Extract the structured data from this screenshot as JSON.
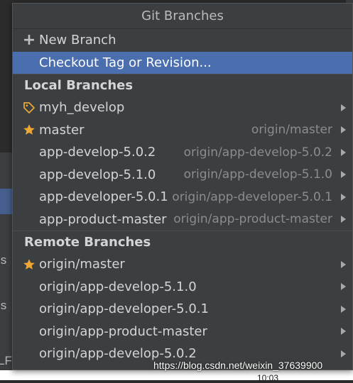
{
  "background": {
    "left_fragments": [
      "is",
      "is",
      "LF"
    ],
    "bottom_clock": "10:03"
  },
  "popup": {
    "title": "Git Branches",
    "actions": [
      {
        "label": "New Branch",
        "icon": "plus-icon"
      },
      {
        "label": "Checkout Tag or Revision...",
        "selected": true
      }
    ],
    "local_header": "Local Branches",
    "local_branches": [
      {
        "name": "myh_develop",
        "tracking": "",
        "icon": "tag-icon"
      },
      {
        "name": "master",
        "tracking": "origin/master",
        "icon": "star-icon"
      },
      {
        "name": "app-develop-5.0.2",
        "tracking": "origin/app-develop-5.0.2"
      },
      {
        "name": "app-develop-5.1.0",
        "tracking": "origin/app-develop-5.1.0"
      },
      {
        "name": "app-developer-5.0.1",
        "tracking": "origin/app-developer-5.0.1"
      },
      {
        "name": "app-product-master",
        "tracking": "origin/app-product-master"
      }
    ],
    "remote_header": "Remote Branches",
    "remote_branches": [
      {
        "name": "origin/master",
        "icon": "star-icon"
      },
      {
        "name": "origin/app-develop-5.1.0"
      },
      {
        "name": "origin/app-developer-5.0.1"
      },
      {
        "name": "origin/app-product-master"
      },
      {
        "name": "origin/app-develop-5.0.2"
      }
    ]
  },
  "watermark": "https://blog.csdn.net/weixin_37639900",
  "colors": {
    "selected_row": "#4b6eaf",
    "star": "#f0a732",
    "tag": "#e8a838"
  }
}
